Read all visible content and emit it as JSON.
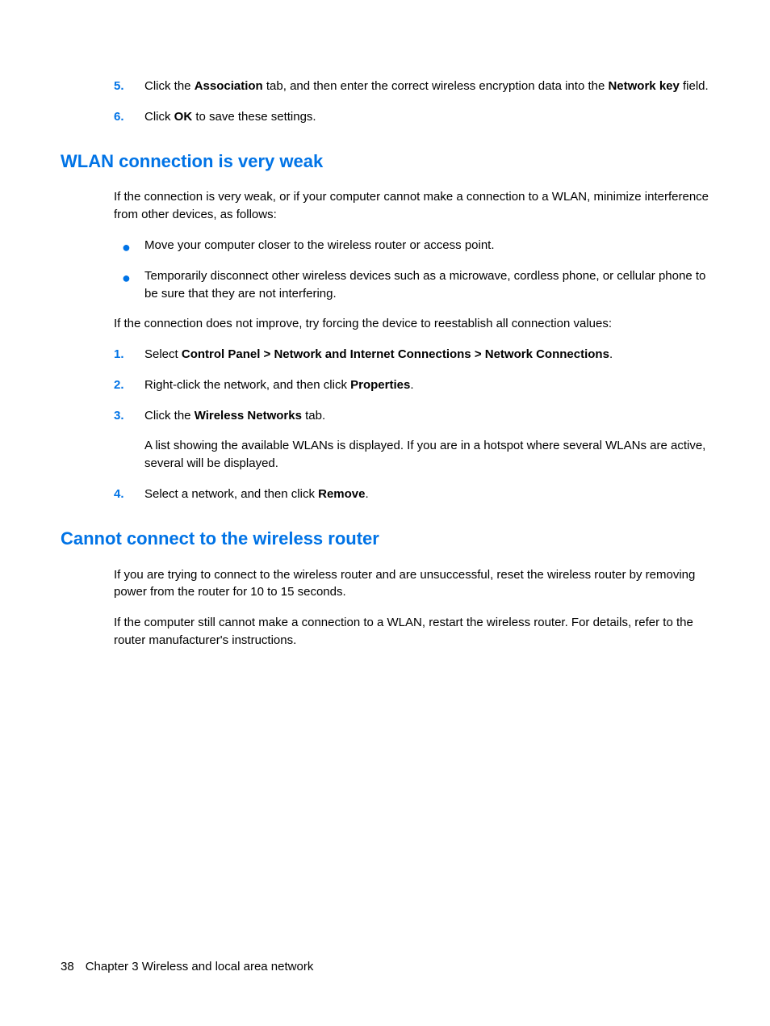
{
  "top_list": {
    "i5": {
      "num": "5.",
      "pre": "Click the ",
      "b1": "Association",
      "mid": " tab, and then enter the correct wireless encryption data into the ",
      "b2": "Network key",
      "post": " field."
    },
    "i6": {
      "num": "6.",
      "pre": "Click ",
      "b1": "OK",
      "post": " to save these settings."
    }
  },
  "h1": "WLAN connection is very weak",
  "s1": {
    "p1": "If the connection is very weak, or if your computer cannot make a connection to a WLAN, minimize interference from other devices, as follows:",
    "b1": "Move your computer closer to the wireless router or access point.",
    "b2": "Temporarily disconnect other wireless devices such as a microwave, cordless phone, or cellular phone to be sure that they are not interfering.",
    "p2": "If the connection does not improve, try forcing the device to reestablish all connection values:",
    "o1": {
      "num": "1.",
      "pre": "Select ",
      "b1": "Control Panel > Network and Internet Connections > Network Connections",
      "post": "."
    },
    "o2": {
      "num": "2.",
      "pre": "Right-click the network, and then click ",
      "b1": "Properties",
      "post": "."
    },
    "o3": {
      "num": "3.",
      "pre": "Click the ",
      "b1": "Wireless Networks",
      "post": " tab."
    },
    "o3sub": "A list showing the available WLANs is displayed. If you are in a hotspot where several WLANs are active, several will be displayed.",
    "o4": {
      "num": "4.",
      "pre": "Select a network, and then click ",
      "b1": "Remove",
      "post": "."
    }
  },
  "h2": "Cannot connect to the wireless router",
  "s2": {
    "p1": "If you are trying to connect to the wireless router and are unsuccessful, reset the wireless router by removing power from the router for 10 to 15 seconds.",
    "p2": "If the computer still cannot make a connection to a WLAN, restart the wireless router. For details, refer to the router manufacturer's instructions."
  },
  "footer": {
    "page": "38",
    "chapter": "Chapter 3   Wireless and local area network"
  },
  "bullet": "●"
}
